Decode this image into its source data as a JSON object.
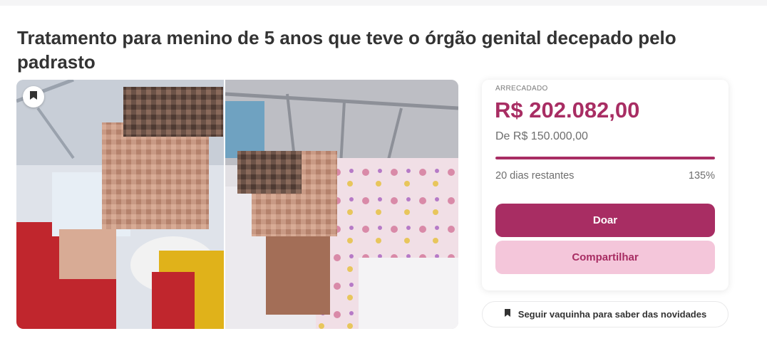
{
  "campaign": {
    "title": "Tratamento para menino de 5 anos que teve o órgão genital decepado pelo padrasto"
  },
  "icons": {
    "save": "bookmark-icon",
    "follow": "bookmark-icon"
  },
  "stats": {
    "raised_label": "ARRECADADO",
    "raised_amount": "R$ 202.082,00",
    "goal_text": "De R$ 150.000,00",
    "days_left": "20 dias restantes",
    "percent": "135%",
    "progress_fraction": 1.0
  },
  "actions": {
    "donate_label": "Doar",
    "share_label": "Compartilhar",
    "follow_label": "Seguir vaquinha para saber das novidades"
  },
  "colors": {
    "brand": "#a82d63",
    "brand_light": "#f4c6da"
  }
}
